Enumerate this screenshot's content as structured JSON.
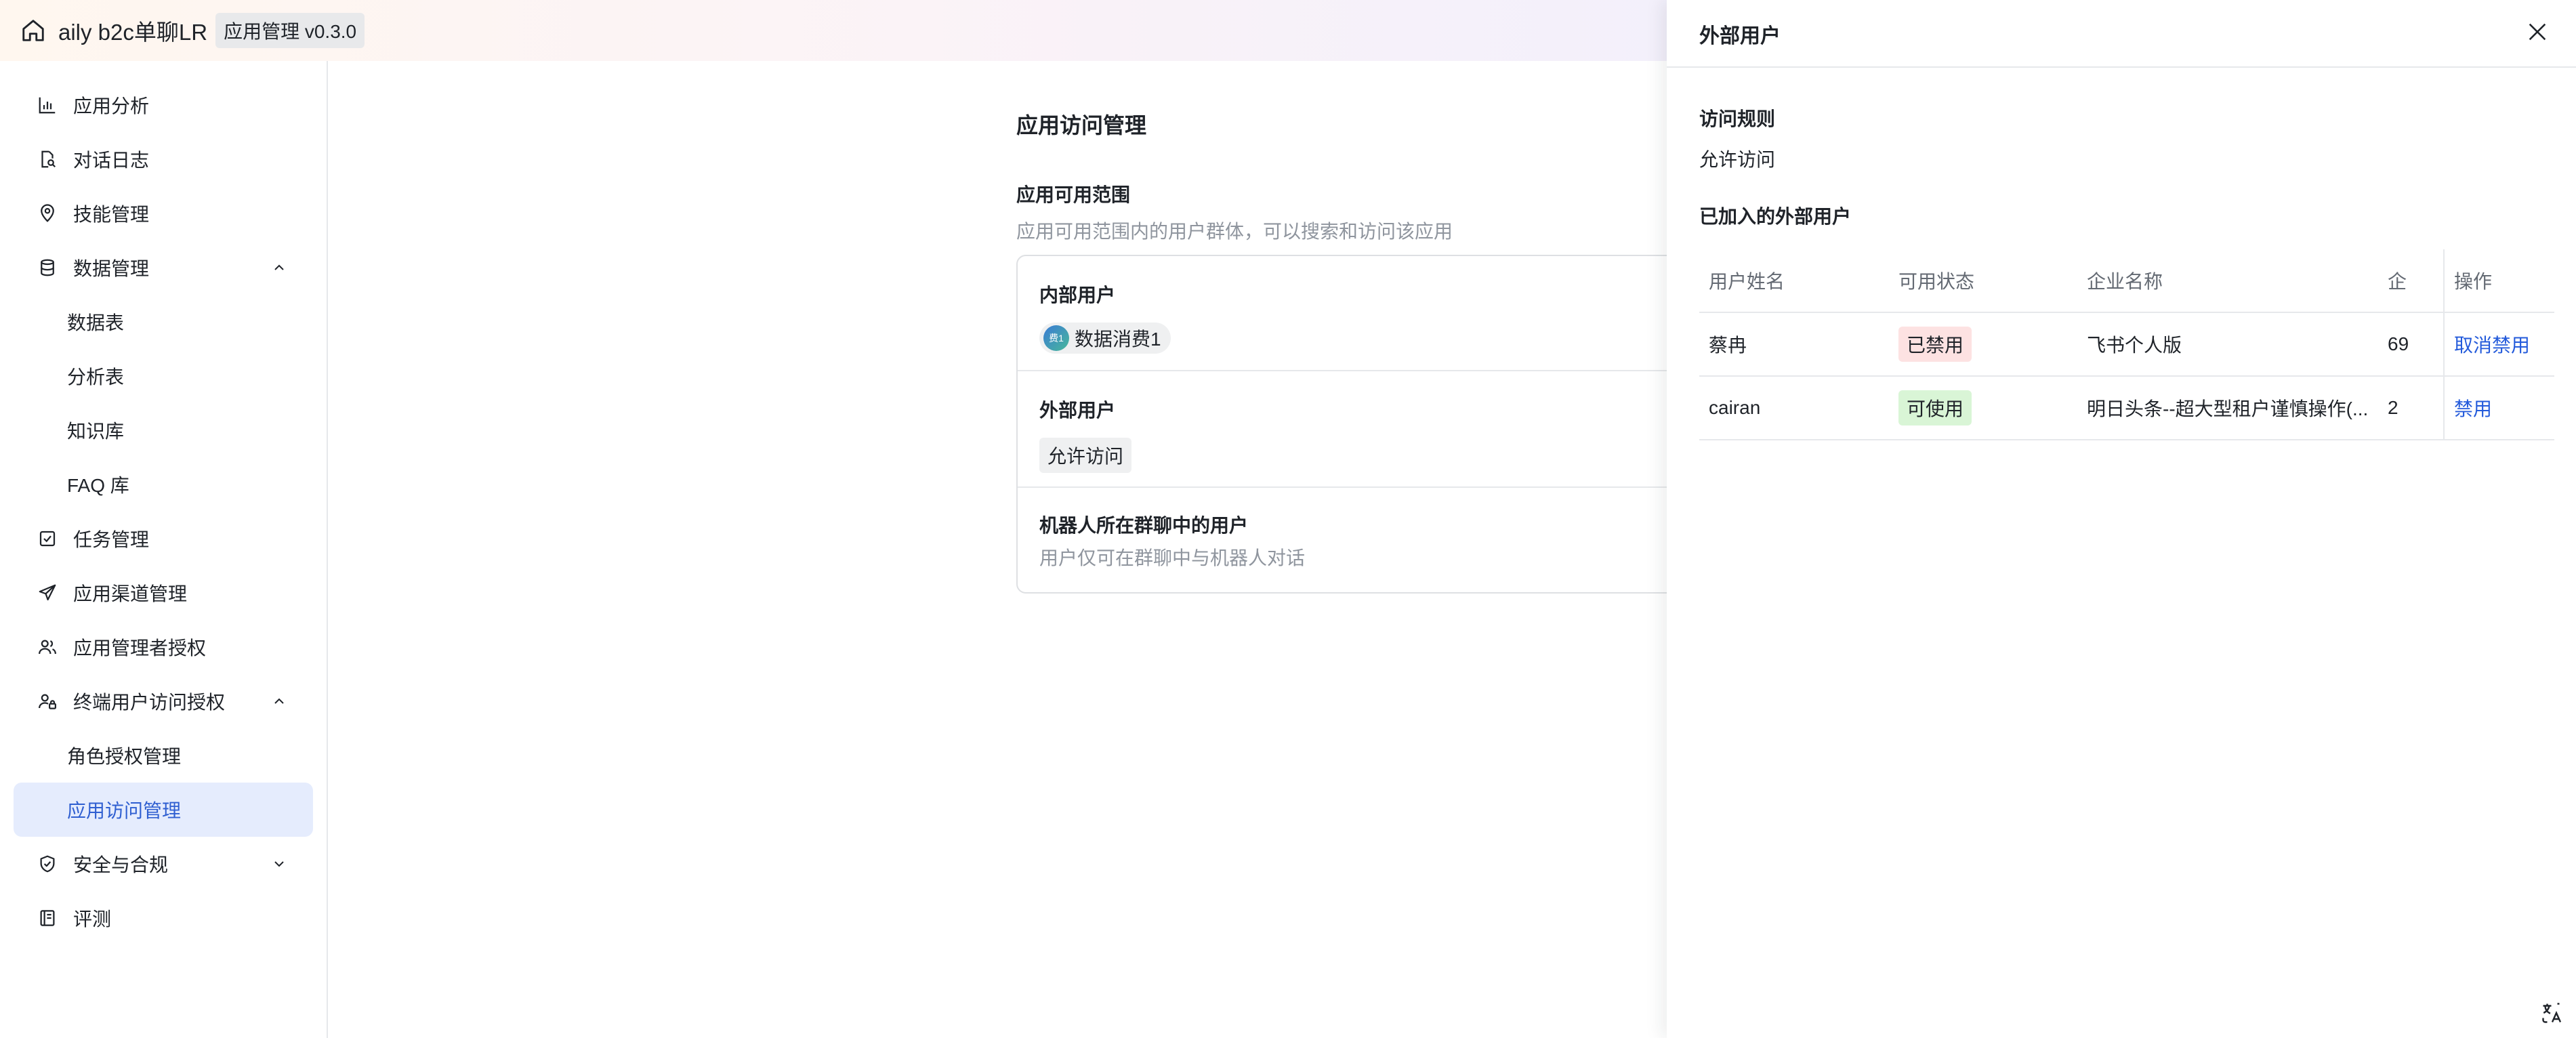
{
  "header": {
    "app_name": "aily b2c单聊LR",
    "badge": "应用管理 v0.3.0"
  },
  "sidebar": {
    "items": [
      {
        "label": "应用分析",
        "icon": "bar-chart-icon"
      },
      {
        "label": "对话日志",
        "icon": "doc-search-icon"
      },
      {
        "label": "技能管理",
        "icon": "location-pin-icon"
      },
      {
        "label": "数据管理",
        "icon": "database-icon",
        "expanded": true
      },
      {
        "label": "数据表"
      },
      {
        "label": "分析表"
      },
      {
        "label": "知识库"
      },
      {
        "label": "FAQ 库"
      },
      {
        "label": "任务管理",
        "icon": "checkbox-icon"
      },
      {
        "label": "应用渠道管理",
        "icon": "send-icon"
      },
      {
        "label": "应用管理者授权",
        "icon": "users-icon"
      },
      {
        "label": "终端用户访问授权",
        "icon": "user-lock-icon",
        "expanded": true
      },
      {
        "label": "角色授权管理"
      },
      {
        "label": "应用访问管理",
        "active": true
      },
      {
        "label": "安全与合规",
        "icon": "shield-check-icon",
        "expanded": false
      },
      {
        "label": "评测",
        "icon": "clipboard-icon"
      }
    ]
  },
  "main": {
    "title": "应用访问管理",
    "scope_title": "应用可用范围",
    "scope_desc": "应用可用范围内的用户群体，可以搜索和访问该应用",
    "internal": {
      "title": "内部用户",
      "chip_label": "数据消费1",
      "avatar_text": "费1"
    },
    "external": {
      "title": "外部用户",
      "tag": "允许访问"
    },
    "group": {
      "title": "机器人所在群聊中的用户",
      "desc": "用户仅可在群聊中与机器人对话"
    }
  },
  "drawer": {
    "title": "外部用户",
    "rule_label": "访问规则",
    "rule_value": "允许访问",
    "joined_label": "已加入的外部用户",
    "columns": [
      "用户姓名",
      "可用状态",
      "企业名称",
      "企",
      "操作"
    ],
    "rows": [
      {
        "name": "蔡冉",
        "status": "已禁用",
        "company": "飞书个人版",
        "code": "69",
        "action": "取消禁用"
      },
      {
        "name": "cairan",
        "status": "可使用",
        "company": "明日头条--超大型租户谨慎操作(...",
        "code": "2",
        "action": "禁用"
      }
    ]
  },
  "colors": {
    "accent": "#245bdb",
    "active_bg": "#e5ecfd",
    "disabled_bg": "#fde2e2",
    "enabled_bg": "#d9f5d6"
  }
}
